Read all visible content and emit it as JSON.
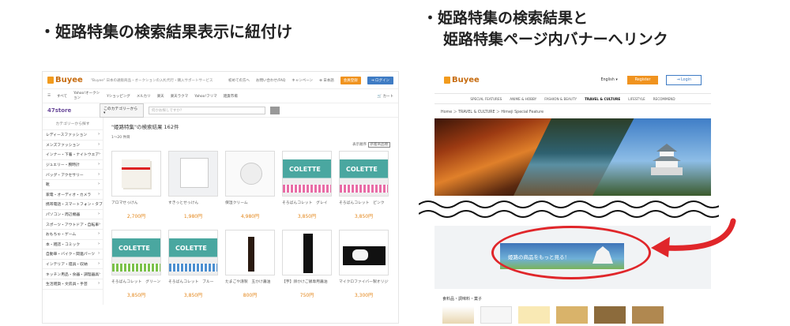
{
  "headings": {
    "left": "・姫路特集の検索結果表示に紐付け",
    "right_line1": "・姫路特集の検索結果と",
    "right_line2": "姫路特集ページ内バナーへリンク"
  },
  "left": {
    "logo": "Buyee",
    "tagline": "\"Buyee\" 日本の通販商品・オークションの入札代行・購入サポートサービス",
    "links": [
      "初めての方へ",
      "お問い合わせ/FAQ",
      "キャンペーン",
      "日本語"
    ],
    "register": "会員登録",
    "login": "ログイン",
    "nav": [
      "すべて",
      "Yahoo!オークション",
      "Yショッピング",
      "メルカリ",
      "楽天",
      "楽天ラクマ",
      "Yahoo!フリマ",
      "雑貨市場"
    ],
    "cart": "カート",
    "store": "47store",
    "category_select": "このカテゴリーから",
    "search_placeholder": "何かお探しですか？",
    "side_header": "カテゴリーから探す",
    "categories": [
      "レディースファッション",
      "メンズファッション",
      "インナー・下着・ナイトウエア",
      "ジュエリー・腕時計",
      "バッグ・アクセサリー",
      "靴",
      "家電・オーディオ・カメラ",
      "携帯電話・スマートフォン・タブレット",
      "パソコン・周辺機器",
      "スポーツ・アウトドア・自転車",
      "おもちゃ・ゲーム",
      "本・雑誌・コミック",
      "自動車・バイク・関連パーツ",
      "インテリア・寝具・収納",
      "キッチン用品・食器・調理器具",
      "生活雑貨・文房具・手芸"
    ],
    "result_title": "\"姫路特集\"の検索結果 162件",
    "count": "1〜20 件目",
    "sort_label": "表示順序",
    "sort_value": "新着商品順",
    "products": [
      {
        "name": "アロマせっけん",
        "price": "2,700円",
        "img": "soap"
      },
      {
        "name": "すきっとせっけん",
        "price": "1,980円",
        "img": "kobe"
      },
      {
        "name": "保湿クリーム",
        "price": "4,980円",
        "img": "cream"
      },
      {
        "name": "そろばんコレット　グレイ",
        "price": "3,850円",
        "img": "col pink"
      },
      {
        "name": "そろばんコレット　ピンク",
        "price": "3,850円",
        "img": "col pink"
      },
      {
        "name": "そろばんコレット　グリーン",
        "price": "3,850円",
        "img": "col green"
      },
      {
        "name": "そろばんコレット　ブルー",
        "price": "3,850円",
        "img": "col blue"
      },
      {
        "name": "たまごや謹製　玉かけ醤油",
        "price": "800円",
        "img": "bottle"
      },
      {
        "name": "【芋】卵かけご飯専用醤油",
        "price": "750円",
        "img": "bottle2"
      },
      {
        "name": "マイクロファイバー製オリジナルゴルフグローブ",
        "price": "3,300円",
        "img": "glove"
      }
    ]
  },
  "right": {
    "logo": "Buyee",
    "lang": "English",
    "register": "Register",
    "login": "Login",
    "nav": [
      "SPECIAL FEATURES",
      "ANIME & HOBBY",
      "FASHION & BEAUTY",
      "TRAVEL & CULTURE",
      "LIFESTYLE",
      "RECOMMEND"
    ],
    "nav_active_index": 3,
    "breadcrumb": "Home ＞ TRAVEL & CULTURE ＞ Himeji Special Feature",
    "banner_text": "姫路の商品をもっと見る！",
    "category": "食料品・調味料・菓子"
  },
  "colors": {
    "accent_orange": "#f0931f",
    "accent_blue": "#3f7cc4",
    "highlight_red": "#e0262a"
  }
}
